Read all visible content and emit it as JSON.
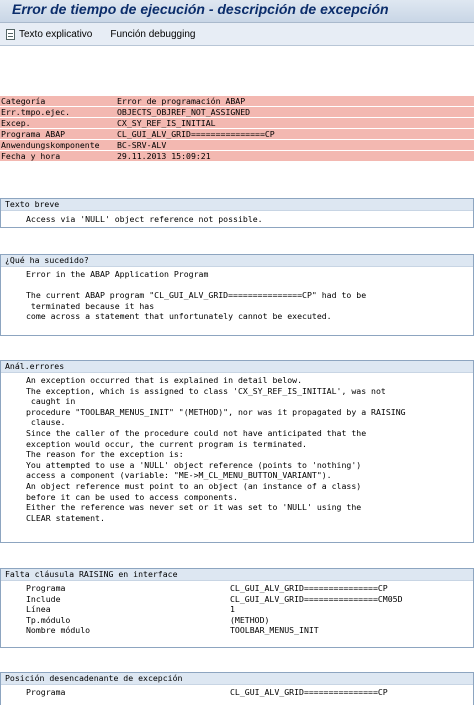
{
  "window": {
    "title": "Error de tiempo de ejecución - descripción de excepción"
  },
  "toolbar": {
    "explain_label": "Texto explicativo",
    "debug_label": "Función debugging"
  },
  "error_header": [
    {
      "label": "Categoría",
      "value": "Error de programación ABAP"
    },
    {
      "label": "Err.tmpo.ejec.",
      "value": "OBJECTS_OBJREF_NOT_ASSIGNED"
    },
    {
      "label": "Excep.",
      "value": "CX_SY_REF_IS_INITIAL"
    },
    {
      "label": "Programa ABAP",
      "value": "CL_GUI_ALV_GRID===============CP"
    },
    {
      "label": "Anwendungskomponente",
      "value": "BC-SRV-ALV"
    },
    {
      "label": "Fecha y hora",
      "value": "29.11.2013 15:09:21"
    }
  ],
  "sections": {
    "short_text": {
      "heading": "Texto breve",
      "lines": [
        "Access via 'NULL' object reference not possible."
      ]
    },
    "what_happened": {
      "heading": "¿Qué ha sucedido?",
      "lines": [
        "Error in the ABAP Application Program",
        "",
        "The current ABAP program \"CL_GUI_ALV_GRID===============CP\" had to be",
        " terminated because it has",
        "come across a statement that unfortunately cannot be executed."
      ]
    },
    "analysis": {
      "heading": "Anál.errores",
      "lines": [
        "An exception occurred that is explained in detail below.",
        "The exception, which is assigned to class 'CX_SY_REF_IS_INITIAL', was not",
        " caught in",
        "procedure \"TOOLBAR_MENUS_INIT\" \"(METHOD)\", nor was it propagated by a RAISING",
        " clause.",
        "Since the caller of the procedure could not have anticipated that the",
        "exception would occur, the current program is terminated.",
        "The reason for the exception is:",
        "You attempted to use a 'NULL' object reference (points to 'nothing')",
        "access a component (variable: \"ME->M_CL_MENU_BUTTON_VARIANT\").",
        "An object reference must point to an object (an instance of a class)",
        "before it can be used to access components.",
        "Either the reference was never set or it was set to 'NULL' using the",
        "CLEAR statement."
      ]
    },
    "raising_missing": {
      "heading": "Falta cláusula RAISING en interface",
      "rows": [
        {
          "key": "Programa",
          "value": "CL_GUI_ALV_GRID===============CP"
        },
        {
          "key": "Include",
          "value": "CL_GUI_ALV_GRID===============CM05D"
        },
        {
          "key": "Línea",
          "value": "1"
        },
        {
          "key": "Tp.módulo",
          "value": "(METHOD)"
        },
        {
          "key": "Nombre módulo",
          "value": "TOOLBAR_MENUS_INIT"
        }
      ]
    },
    "trigger_position": {
      "heading": "Posición desencadenante de excepción",
      "rows": [
        {
          "key": "Programa",
          "value": "CL_GUI_ALV_GRID===============CP"
        }
      ]
    }
  }
}
